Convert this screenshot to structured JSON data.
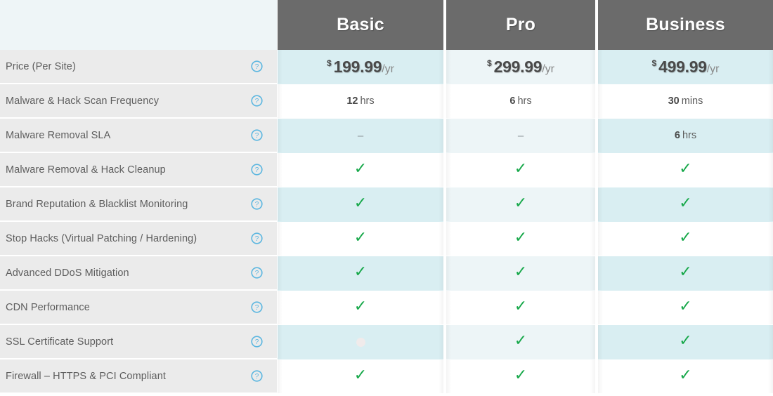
{
  "table": {
    "corner_label": "",
    "plans": [
      {
        "id": "basic",
        "name": "Basic"
      },
      {
        "id": "pro",
        "name": "Pro"
      },
      {
        "id": "business",
        "name": "Business"
      }
    ],
    "help_icon": "help-circle-icon",
    "check_glyph": "✓",
    "dash_glyph": "–",
    "currency_symbol": "$",
    "period_label": "/yr",
    "colors": {
      "header_bg": "#6b6b6b",
      "corner_bg": "#eef5f7",
      "feature_bg": "#ebebeb",
      "tint_strong": "#d9eef2",
      "tint_light": "#edf5f7",
      "check_green": "#17a84a",
      "help_blue": "#5bb6e0",
      "label_text": "#5d5d5d"
    },
    "rows": [
      {
        "label": "Price (Per Site)",
        "type": "price",
        "striped": true,
        "values": [
          {
            "kind": "price",
            "amount": "199.99"
          },
          {
            "kind": "price",
            "amount": "299.99"
          },
          {
            "kind": "price",
            "amount": "499.99"
          }
        ]
      },
      {
        "label": "Malware & Hack Scan Frequency",
        "type": "duration",
        "striped": false,
        "values": [
          {
            "kind": "duration",
            "num": "12",
            "unit": "hrs"
          },
          {
            "kind": "duration",
            "num": "6",
            "unit": "hrs"
          },
          {
            "kind": "duration",
            "num": "30",
            "unit": "mins"
          }
        ]
      },
      {
        "label": "Malware Removal SLA",
        "type": "duration",
        "striped": true,
        "values": [
          {
            "kind": "dash"
          },
          {
            "kind": "dash"
          },
          {
            "kind": "duration",
            "num": "6",
            "unit": "hrs"
          }
        ]
      },
      {
        "label": "Malware Removal & Hack Cleanup",
        "type": "check",
        "striped": false,
        "values": [
          {
            "kind": "check"
          },
          {
            "kind": "check"
          },
          {
            "kind": "check"
          }
        ]
      },
      {
        "label": "Brand Reputation & Blacklist Monitoring",
        "type": "check",
        "striped": true,
        "values": [
          {
            "kind": "check"
          },
          {
            "kind": "check"
          },
          {
            "kind": "check"
          }
        ]
      },
      {
        "label": "Stop Hacks (Virtual Patching / Hardening)",
        "type": "check",
        "striped": false,
        "values": [
          {
            "kind": "check"
          },
          {
            "kind": "check"
          },
          {
            "kind": "check"
          }
        ]
      },
      {
        "label": "Advanced DDoS Mitigation",
        "type": "check",
        "striped": true,
        "values": [
          {
            "kind": "check"
          },
          {
            "kind": "check"
          },
          {
            "kind": "check"
          }
        ]
      },
      {
        "label": "CDN Performance",
        "type": "check",
        "striped": false,
        "values": [
          {
            "kind": "check"
          },
          {
            "kind": "check"
          },
          {
            "kind": "check"
          }
        ]
      },
      {
        "label": "SSL Certificate Support",
        "type": "check",
        "striped": true,
        "values": [
          {
            "kind": "faded"
          },
          {
            "kind": "check"
          },
          {
            "kind": "check"
          }
        ]
      },
      {
        "label": "Firewall – HTTPS & PCI Compliant",
        "type": "check",
        "striped": false,
        "values": [
          {
            "kind": "check"
          },
          {
            "kind": "check"
          },
          {
            "kind": "check"
          }
        ]
      }
    ]
  }
}
